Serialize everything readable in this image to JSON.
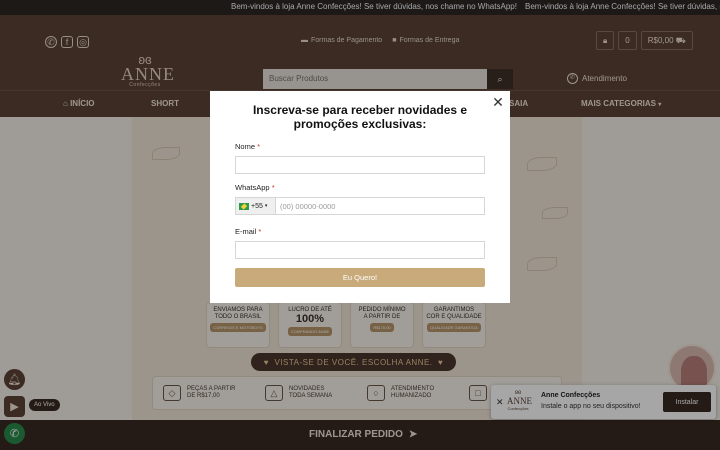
{
  "announcement": {
    "text_1": "Bem-vindos à loja Anne Confecções! Se tiver dúvidas, nos chame no WhatsApp!",
    "text_2": "Bem-vindos à loja Anne Confecções! Se tiver dúvidas, n"
  },
  "header": {
    "links": {
      "payment": "Formas de Pagamento",
      "delivery": "Formas de Entrega"
    },
    "cart": {
      "count": "0",
      "total": "R$0,00"
    },
    "logo": {
      "name": "ANNE",
      "sub": "Confecções"
    },
    "search": {
      "placeholder": "Buscar Produtos"
    },
    "support": "Atendimento"
  },
  "nav": {
    "items": [
      "INÍCIO",
      "SHORT",
      "SAIA",
      "MAIS CATEGORIAS"
    ]
  },
  "features": [
    {
      "line1": "ENVIAMOS PARA",
      "line2": "TODO O BRASIL",
      "tag": "CORREIOS E MOTOBOYS"
    },
    {
      "line1": "LUCRO DE ATÉ",
      "big": "100%",
      "tag": "COMPRANDO ANNE"
    },
    {
      "line1": "PEDIDO MÍNIMO",
      "line2": "A PARTIR DE",
      "tag": "R$170,00"
    },
    {
      "line1": "GARANTIMOS",
      "line2": "COR E QUALIDADE",
      "tag": "QUALIDADE GARANTIDA"
    }
  ],
  "slogan": "VISTA-SE DE VOCÊ. ESCOLHA ANNE.",
  "benefits": [
    {
      "line1": "PEÇAS A PARTIR",
      "line2": "DE R$17,00"
    },
    {
      "line1": "NOVIDADES",
      "line2": "TODA SEMANA"
    },
    {
      "line1": "ATENDIMENTO",
      "line2": "HUMANIZADO"
    }
  ],
  "bottom_bar": {
    "checkout": "FINALIZAR PEDIDO"
  },
  "live": {
    "label": "Ao Vivo"
  },
  "install_banner": {
    "logo_name": "ANNE",
    "logo_sub": "Confecções",
    "title": "Anne Confecções",
    "subtitle": "Instale o app no seu dispositivo!",
    "button": "Instalar"
  },
  "modal": {
    "title": "Inscreva-se para receber novidades e promoções exclusivas:",
    "name_label": "Nome",
    "whatsapp_label": "WhatsApp",
    "country_code": "+55",
    "phone_placeholder": "(00) 00000-0000",
    "email_label": "E-mail",
    "required_mark": "*",
    "submit": "Eu Quero!"
  },
  "colors": {
    "brand_brown": "#5b4336",
    "dark_brown": "#3a2a23",
    "submit_gold": "#c9aa7b",
    "required_red": "#c0392b"
  }
}
